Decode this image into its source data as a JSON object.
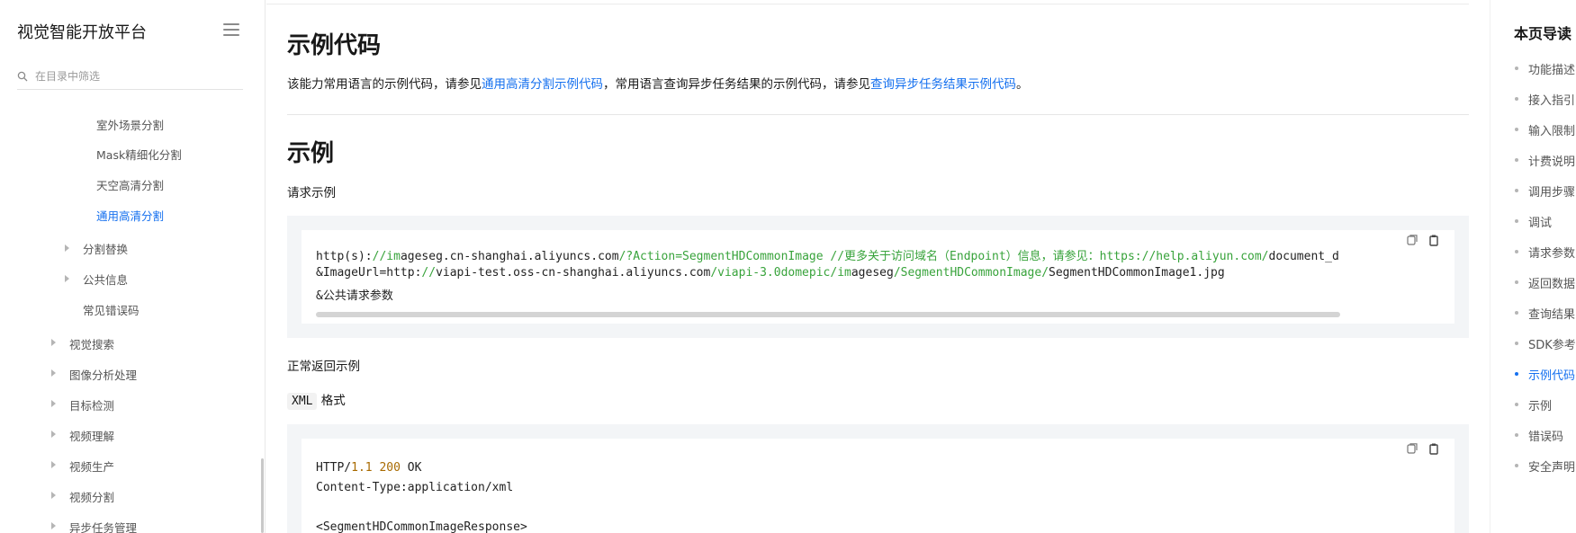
{
  "sidebar": {
    "brand": "视觉智能开放平台",
    "filter_placeholder": "在目录中筛选",
    "items": [
      {
        "label": "室外场景分割"
      },
      {
        "label": "Mask精细化分割"
      },
      {
        "label": "天空高清分割"
      },
      {
        "label": "通用高清分割",
        "active": true
      },
      {
        "label": "分割替换"
      },
      {
        "label": "公共信息"
      },
      {
        "label": "常见错误码"
      },
      {
        "label": "视觉搜索"
      },
      {
        "label": "图像分析处理"
      },
      {
        "label": "目标检测"
      },
      {
        "label": "视频理解"
      },
      {
        "label": "视频生产"
      },
      {
        "label": "视频分割"
      },
      {
        "label": "异步任务管理"
      }
    ]
  },
  "main": {
    "sample_code_title": "示例代码",
    "sample_code_text_1": "该能力常用语言的示例代码，请参见",
    "sample_code_link_1": "通用高清分割示例代码",
    "sample_code_text_2": "，常用语言查询异步任务结果的示例代码，请参见",
    "sample_code_link_2": "查询异步任务结果示例代码",
    "sample_code_text_3": "。",
    "example_title": "示例",
    "request_label": "请求示例",
    "request_code": {
      "l1_a": "http(s):",
      "l1_b": "//im",
      "l1_c": "ageseg.cn-shanghai.aliyuncs.com",
      "l1_d": "/?Action=SegmentHDCommonImage",
      "l1_e": "      //更多关于访问域名（Endpoint）信息，请参见：https://help.aliyun.com/",
      "l1_f": "document_d",
      "l2_a": "&ImageUrl=http:",
      "l2_b": "//",
      "l2_c": "viapi-test.oss-cn-shanghai.aliyuncs.com",
      "l2_d": "/viapi-3.0domepic/im",
      "l2_e": "ageseg",
      "l2_f": "/SegmentHDCommonImage/",
      "l2_g": "SegmentHDCommonImage1.jpg",
      "l3": "&公共请求参数"
    },
    "response_label": "正常返回示例",
    "format_code": "XML",
    "format_suffix": " 格式",
    "response_code": {
      "l1_a": "HTTP/",
      "l1_b": "1.1 200",
      "l1_c": " OK",
      "l2": "Content-Type:application/xml",
      "l4": "<SegmentHDCommonImageResponse>"
    }
  },
  "toc": {
    "title": "本页导读",
    "items": [
      {
        "label": "功能描述"
      },
      {
        "label": "接入指引"
      },
      {
        "label": "输入限制"
      },
      {
        "label": "计费说明"
      },
      {
        "label": "调用步骤"
      },
      {
        "label": "调试"
      },
      {
        "label": "请求参数"
      },
      {
        "label": "返回数据"
      },
      {
        "label": "查询结果"
      },
      {
        "label": "SDK参考"
      },
      {
        "label": "示例代码",
        "active": true
      },
      {
        "label": "示例"
      },
      {
        "label": "错误码"
      },
      {
        "label": "安全声明"
      }
    ]
  },
  "colors": {
    "accent": "#1570ef",
    "code_green": "#38a33b",
    "code_orange": "#a86a00"
  },
  "icons": [
    "menu-icon",
    "search-icon",
    "copy-icon",
    "clipboard-icon",
    "caret-right-icon"
  ]
}
